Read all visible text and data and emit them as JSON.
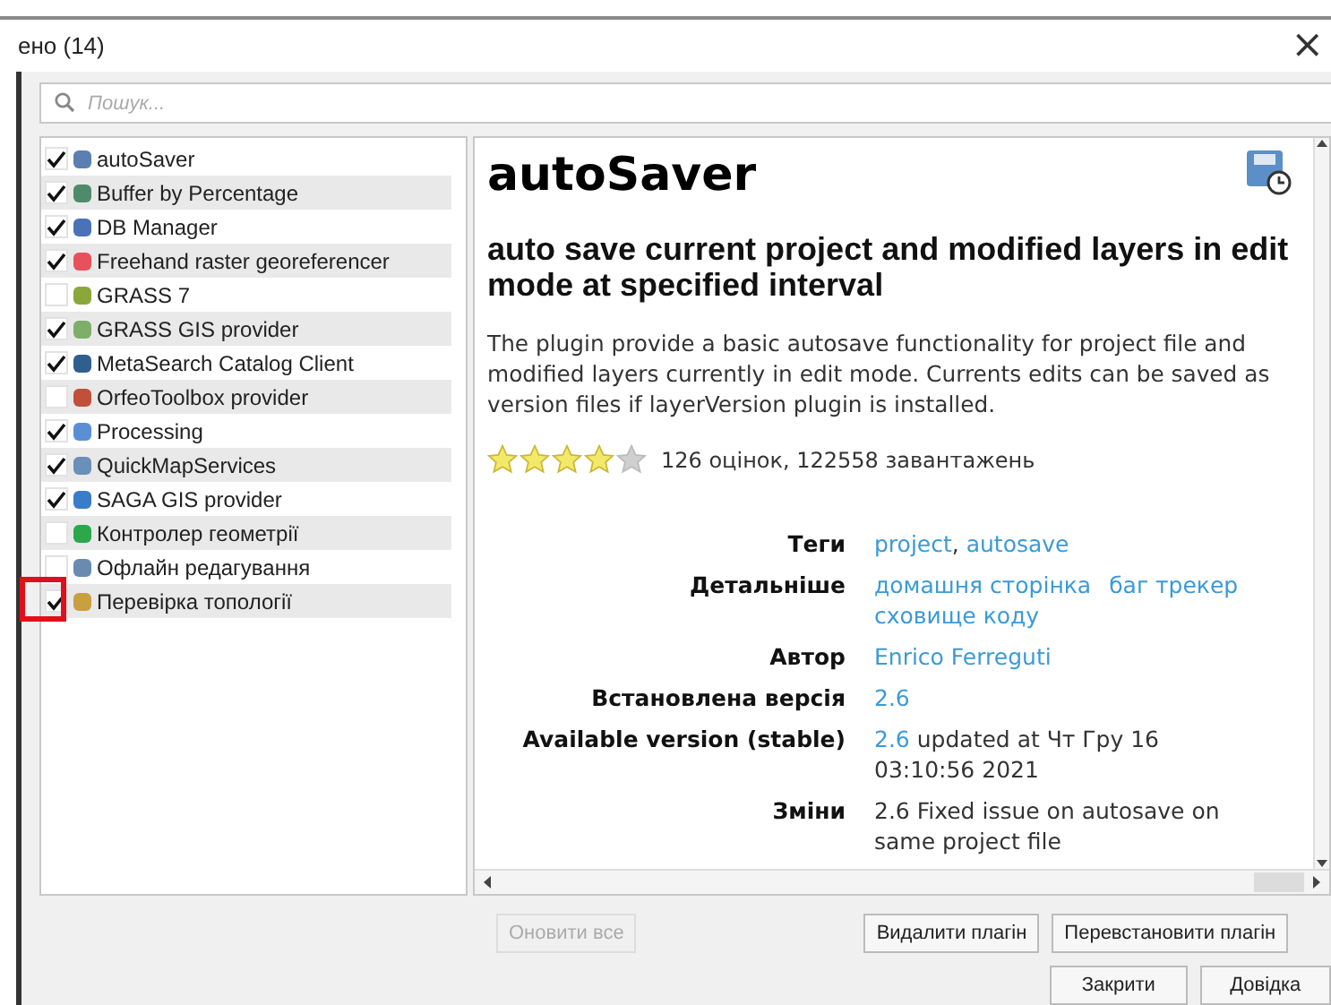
{
  "window": {
    "title": "ено (14)",
    "close": "×"
  },
  "search": {
    "placeholder": "Пошук..."
  },
  "plugins": [
    {
      "name": "autoSaver",
      "checked": true,
      "color": "#5b7fb0",
      "highlighted": false
    },
    {
      "name": "Buffer by Percentage",
      "checked": true,
      "color": "#4f8a6a",
      "highlighted": false
    },
    {
      "name": "DB Manager",
      "checked": true,
      "color": "#4a72b8",
      "highlighted": false
    },
    {
      "name": "Freehand raster georeferencer",
      "checked": true,
      "color": "#e8505b",
      "highlighted": false
    },
    {
      "name": "GRASS 7",
      "checked": false,
      "color": "#8aa83a",
      "highlighted": false
    },
    {
      "name": "GRASS GIS provider",
      "checked": true,
      "color": "#7fae6a",
      "highlighted": false
    },
    {
      "name": "MetaSearch Catalog Client",
      "checked": true,
      "color": "#2f5f8f",
      "highlighted": false
    },
    {
      "name": "OrfeoToolbox provider",
      "checked": false,
      "color": "#c0503a",
      "highlighted": false
    },
    {
      "name": "Processing",
      "checked": true,
      "color": "#5a8fd6",
      "highlighted": false
    },
    {
      "name": "QuickMapServices",
      "checked": true,
      "color": "#6a8fb8",
      "highlighted": false
    },
    {
      "name": "SAGA GIS provider",
      "checked": true,
      "color": "#3a7cc8",
      "highlighted": false
    },
    {
      "name": "Контролер геометрії",
      "checked": false,
      "color": "#2aa84a",
      "highlighted": false
    },
    {
      "name": "Офлайн редагування",
      "checked": false,
      "color": "#6a8ab0",
      "highlighted": false
    },
    {
      "name": "Перевірка топології",
      "checked": true,
      "color": "#c8a040",
      "highlighted": true
    }
  ],
  "details": {
    "title": "autoSaver",
    "subtitle": "auto save current project and modified layers in edit mode at specified interval",
    "description": "The plugin provide a basic autosave functionality for project file and modified layers currently in edit mode. Currents edits can be saved as version files if layerVersion plugin is installed.",
    "stars": 4,
    "rating": "126 оцінок, 122558 завантажень",
    "fields": [
      {
        "label": "Теги",
        "parts": [
          {
            "text": "project",
            "link": true
          },
          {
            "text": ", ",
            "link": false
          },
          {
            "text": "autosave",
            "link": true
          }
        ]
      },
      {
        "label": "Детальніше",
        "parts": [
          {
            "text": "домашня сторінка",
            "link": true
          },
          {
            "text": "баг трекер",
            "link": true
          },
          {
            "text": "сховище коду",
            "link": true
          }
        ]
      },
      {
        "label": "Автор",
        "parts": [
          {
            "text": "Enrico Ferreguti",
            "link": true
          }
        ]
      },
      {
        "label": "Встановлена версія",
        "parts": [
          {
            "text": "2.6",
            "link": true
          }
        ]
      },
      {
        "label": "Available version (stable)",
        "parts": [
          {
            "text": "2.6",
            "link": true
          },
          {
            "text": " updated at Чт Гру 16 03:10:56 2021",
            "link": false
          }
        ]
      },
      {
        "label": "Зміни",
        "parts": [
          {
            "text": "2.6 Fixed issue on autosave on same project file",
            "link": false
          }
        ]
      }
    ]
  },
  "buttons": [
    {
      "label": "Оновити все",
      "disabled": true
    },
    {
      "label": "Видалити плагін",
      "disabled": false
    },
    {
      "label": "Перевстановити плагін",
      "disabled": false
    }
  ],
  "footer_buttons": [
    {
      "label": "Закрити"
    },
    {
      "label": "Довідка"
    }
  ]
}
